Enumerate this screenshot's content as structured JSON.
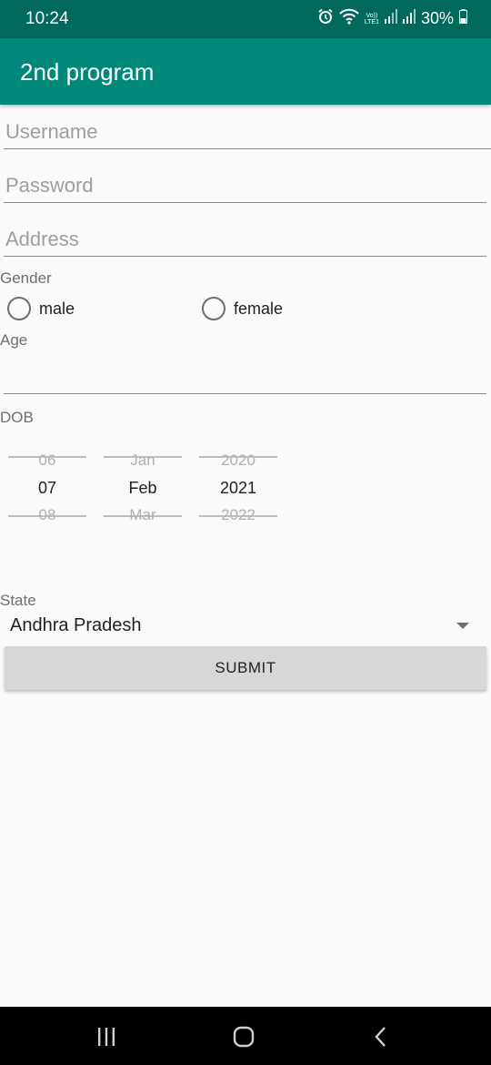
{
  "status_bar": {
    "time": "10:24",
    "network_label_top": "Vo))",
    "network_label_bottom": "LTE1",
    "battery": "30%"
  },
  "app_bar": {
    "title": "2nd program"
  },
  "form": {
    "username": {
      "placeholder": "Username",
      "value": ""
    },
    "password": {
      "placeholder": "Password",
      "value": ""
    },
    "address": {
      "placeholder": "Address",
      "value": ""
    },
    "gender": {
      "label": "Gender",
      "options": [
        "male",
        "female"
      ],
      "selected": null
    },
    "age": {
      "label": "Age",
      "value": ""
    },
    "dob": {
      "label": "DOB",
      "day": {
        "prev": "06",
        "selected": "07",
        "next": "08"
      },
      "month": {
        "prev": "Jan",
        "selected": "Feb",
        "next": "Mar"
      },
      "year": {
        "prev": "2020",
        "selected": "2021",
        "next": "2022"
      }
    },
    "state": {
      "label": "State",
      "selected": "Andhra Pradesh"
    },
    "submit_label": "SUBMIT"
  },
  "colors": {
    "status_bar": "#00695c",
    "app_bar": "#00897b",
    "background": "#fafafa",
    "button": "#d6d7d7",
    "nav_bar": "#000000"
  },
  "nav_bar": {
    "icons": [
      "recents-icon",
      "home-icon",
      "back-icon"
    ]
  }
}
